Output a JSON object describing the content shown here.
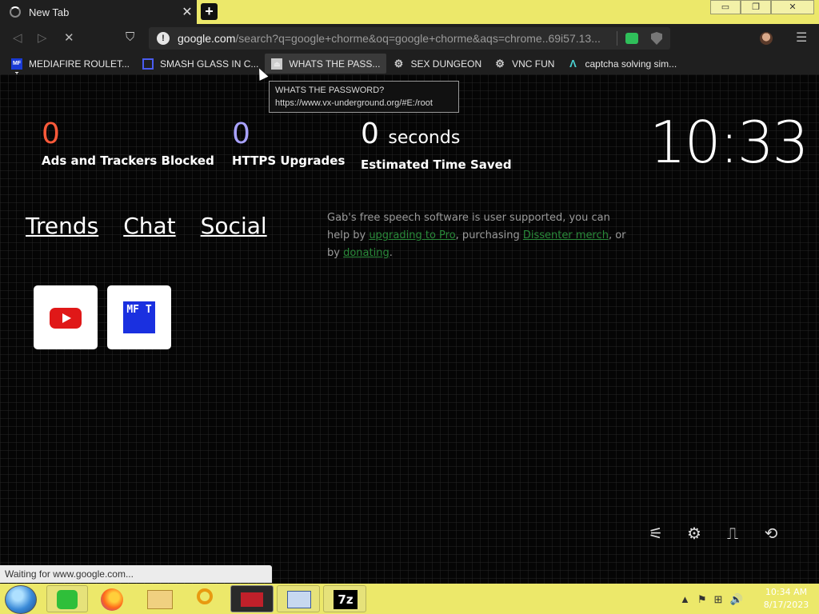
{
  "tab": {
    "title": "New Tab",
    "close": "✕"
  },
  "newtab": "+",
  "window": {
    "min": "▭",
    "restore": "❐",
    "close": "✕"
  },
  "toolbar": {
    "back": "◁",
    "forward": "▷",
    "stop": "✕",
    "bookmark": "⛉",
    "info": "!",
    "url_host": "google.com",
    "url_rest": "/search?q=google+chorme&oq=google+chorme&aqs=chrome..69i57.13...",
    "menu": "☰"
  },
  "bookmarks": [
    {
      "label": "MEDIAFIRE ROULET...",
      "icon": "mft-icon",
      "glyph": "MF T"
    },
    {
      "label": "SMASH GLASS IN C...",
      "icon": "smash-icon",
      "glyph": ""
    },
    {
      "label": "WHATS THE PASS...",
      "icon": "password-icon",
      "glyph": "⏏"
    },
    {
      "label": "SEX DUNGEON",
      "icon": "gear-icon",
      "glyph": "⚙"
    },
    {
      "label": "VNC FUN",
      "icon": "gear-icon",
      "glyph": "⚙"
    },
    {
      "label": "captcha solving sim...",
      "icon": "captcha-icon",
      "glyph": "Λ"
    }
  ],
  "tooltip": {
    "title": "WHATS THE PASSWORD?",
    "url": "https://www.vx-underground.org/#E:/root"
  },
  "stats": {
    "ads": {
      "num": "0",
      "label": "Ads and Trackers Blocked",
      "color": "#ff5a3a"
    },
    "https": {
      "num": "0",
      "label": "HTTPS Upgrades",
      "color": "#a9a2ff"
    },
    "time": {
      "num": "0",
      "unit": "seconds",
      "label": "Estimated Time Saved"
    }
  },
  "clock": "10:33",
  "links": [
    "Trends",
    "Chat",
    "Social"
  ],
  "gab": {
    "t1": "Gab's free speech software is user supported, you can help by ",
    "l1": "upgrading to Pro",
    "t2": ", purchasing ",
    "l2": "Dissenter merch",
    "t3": ", or by ",
    "l3": "donating",
    "t4": "."
  },
  "tiles": [
    {
      "name": "YouTube"
    },
    {
      "name": "MFT",
      "glyph": "MF T"
    }
  ],
  "bottom_icons": [
    "⚟",
    "⚙",
    "⎍",
    "⟲"
  ],
  "status": "Waiting for www.google.com...",
  "taskbar": {
    "time": "10:34 AM",
    "date": "8/17/2023",
    "7z": "7z"
  },
  "tray": [
    "▲",
    "⚑",
    "⊞",
    "🔊"
  ]
}
